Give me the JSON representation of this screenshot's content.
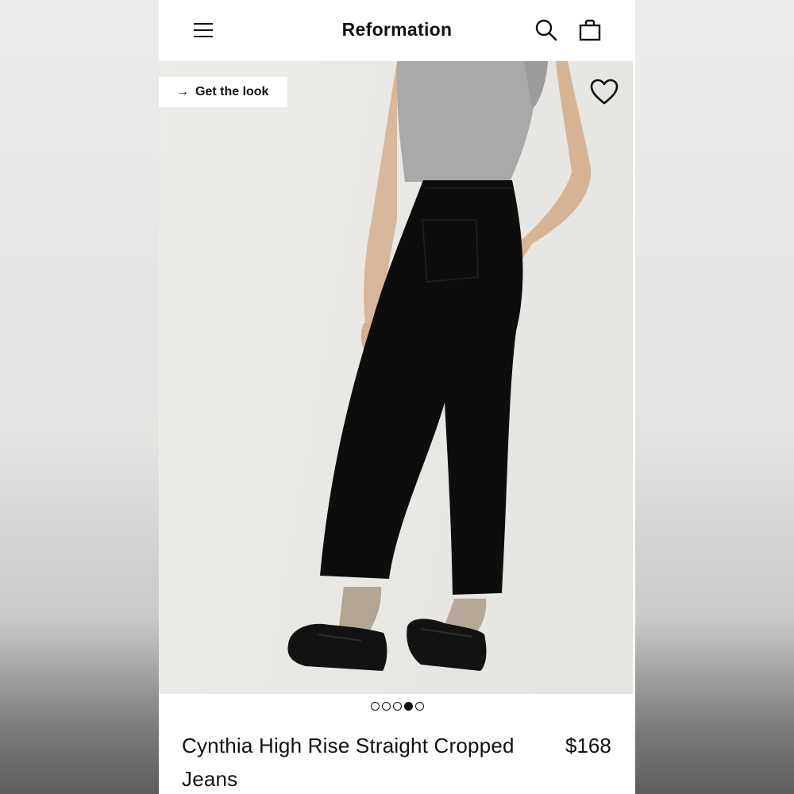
{
  "header": {
    "brand": "Reformation",
    "icons": {
      "menu": "menu-icon",
      "search": "search-icon",
      "bag": "bag-icon"
    }
  },
  "hero": {
    "get_look_label": "Get the look",
    "get_look_icon": "arrow-right-icon",
    "wishlist_icon": "heart-icon"
  },
  "carousel": {
    "dots": [
      "",
      "",
      "",
      "",
      ""
    ],
    "active_index": 3
  },
  "product": {
    "title": "Cynthia High Rise Straight Cropped Jeans",
    "price": "$168"
  }
}
